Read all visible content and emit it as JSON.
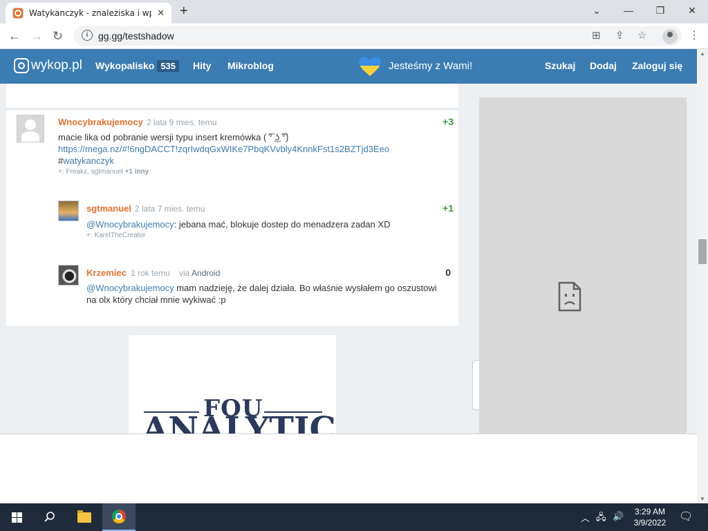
{
  "browser": {
    "tab_title": "Watykanczyk - znaleziska i wpisy",
    "tab_close": "✕",
    "new_tab": "+",
    "window_controls": [
      "⌄",
      "—",
      "❐",
      "✕"
    ],
    "url": "gg.gg/testshadow",
    "nav": {
      "back": "←",
      "forward": "→",
      "reload": "↻"
    }
  },
  "site_nav": {
    "logo": "wykop.pl",
    "items": [
      {
        "label": "Wykopalisko",
        "badge": "535"
      },
      {
        "label": "Hity"
      },
      {
        "label": "Mikroblog"
      }
    ],
    "banner": "Jesteśmy z Wami!",
    "right_items": [
      "Szukaj",
      "Dodaj",
      "Zaloguj się"
    ]
  },
  "comments": [
    {
      "user": "Wnocybrakujemocy",
      "time": "2 lata 9 mies. temu",
      "score": "+3",
      "text": "macie lika od pobranie wersji typu insert kremówka ( ͡° ͜ʖ ͡°)",
      "link": "https://mega.nz/#!6ngDACCT!zqrIwdqGxWIKe7PbqKVvbly4KnnkFst1s2BZTjd3Eeo",
      "tag_hash": "#",
      "tag": "watykanczyk",
      "plus_prefix": "+:",
      "plus_users": "Freakz, sgtmanuel",
      "plus_more": "+1 inny"
    },
    {
      "user": "sgtmanuel",
      "time": "2 lata 7 mies. temu",
      "score": "+1",
      "mention": "@Wnocybrakujemocy",
      "text": ": jebana mać, blokuje dostep do menadzera zadan XD",
      "plus_prefix": "+:",
      "plus_users": "KarelTheCreator"
    },
    {
      "user": "Krzemiec",
      "time": "1 rok temu",
      "via_prefix": "via",
      "via": "Android",
      "score": "0",
      "mention": "@Wnocybrakujemocy",
      "text_line1": " mam nadzieję, że dalej działa. Bo właśnie wysłałem go oszustowi",
      "text_line2": "na olx który chciał mnie wykiwać :p"
    }
  ],
  "ad": {
    "line1": "FOU",
    "line2": "ANALYTICS"
  },
  "taskbar": {
    "time": "3:29 AM",
    "date": "3/9/2022"
  },
  "colors": {
    "nav_bg": "#3b7cb3",
    "username": "#e4712d",
    "score_positive": "#3a9a3a",
    "score_zero": "#333333",
    "link": "#3b7cb3"
  }
}
